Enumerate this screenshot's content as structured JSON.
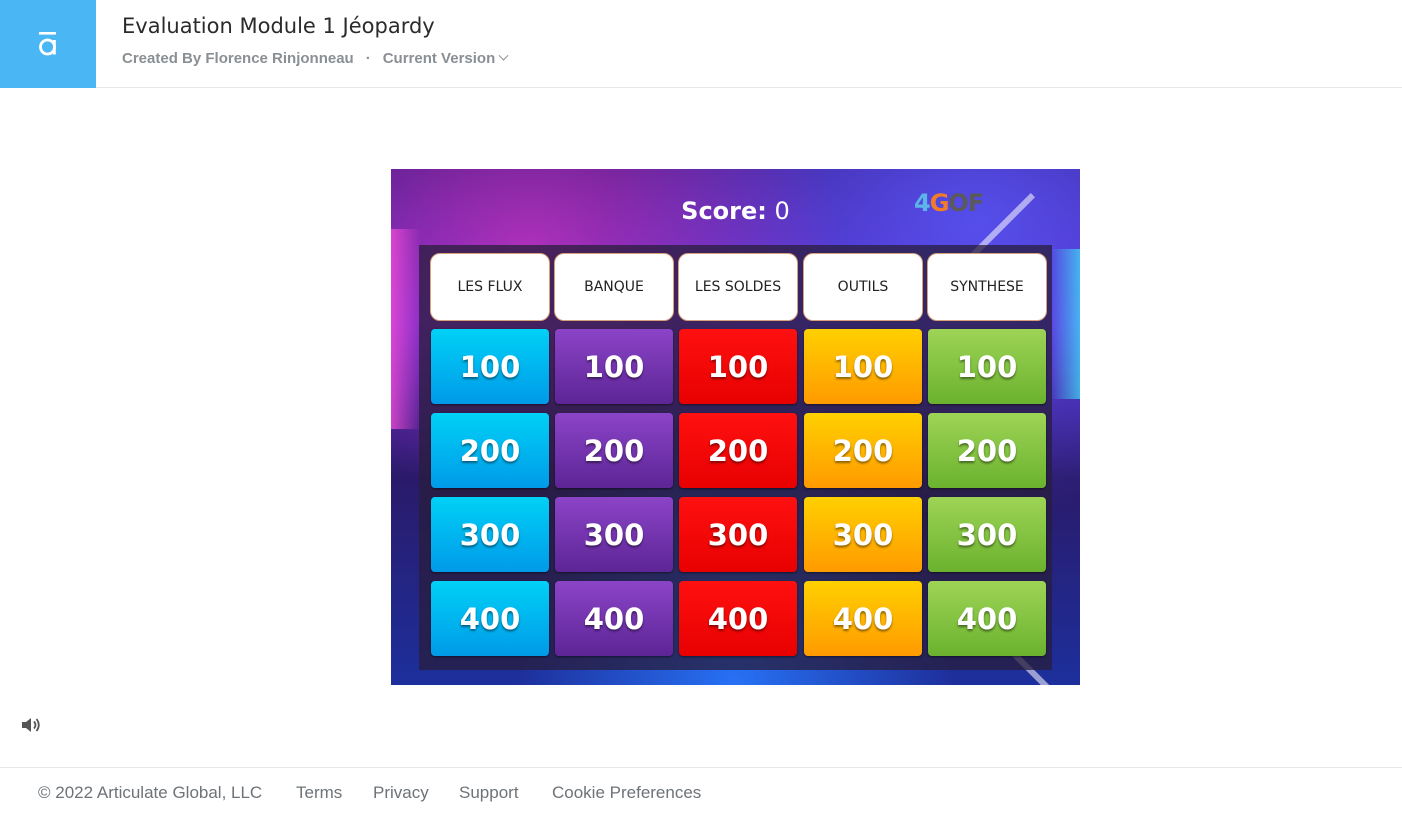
{
  "header": {
    "title": "Evaluation Module 1 Jéopardy",
    "created_by": "Created By Florence Rinjonneau",
    "separator": "·",
    "version_label": "Current Version",
    "logo_icon": "articulate-a-icon",
    "logo_color": "#4ab7f4"
  },
  "game": {
    "score_label": "Score:",
    "score_value": "0",
    "brand": {
      "part1": "4",
      "part2": "G",
      "part3": "O",
      "part4": "F"
    },
    "categories": [
      "LES FLUX",
      "BANQUE",
      "LES SOLDES",
      "OUTILS",
      "SYNTHESE"
    ],
    "rows": [
      [
        "100",
        "100",
        "100",
        "100",
        "100"
      ],
      [
        "200",
        "200",
        "200",
        "200",
        "200"
      ],
      [
        "300",
        "300",
        "300",
        "300",
        "300"
      ],
      [
        "400",
        "400",
        "400",
        "400",
        "400"
      ]
    ],
    "column_colors": [
      "#00b3f0",
      "#7033b0",
      "#ff0000",
      "#ffb800",
      "#82c443"
    ]
  },
  "player": {
    "sound_icon": "speaker-icon"
  },
  "footer": {
    "copyright": "© 2022 Articulate Global, LLC",
    "terms": "Terms",
    "privacy": "Privacy",
    "support": "Support",
    "cookie": "Cookie Preferences"
  }
}
